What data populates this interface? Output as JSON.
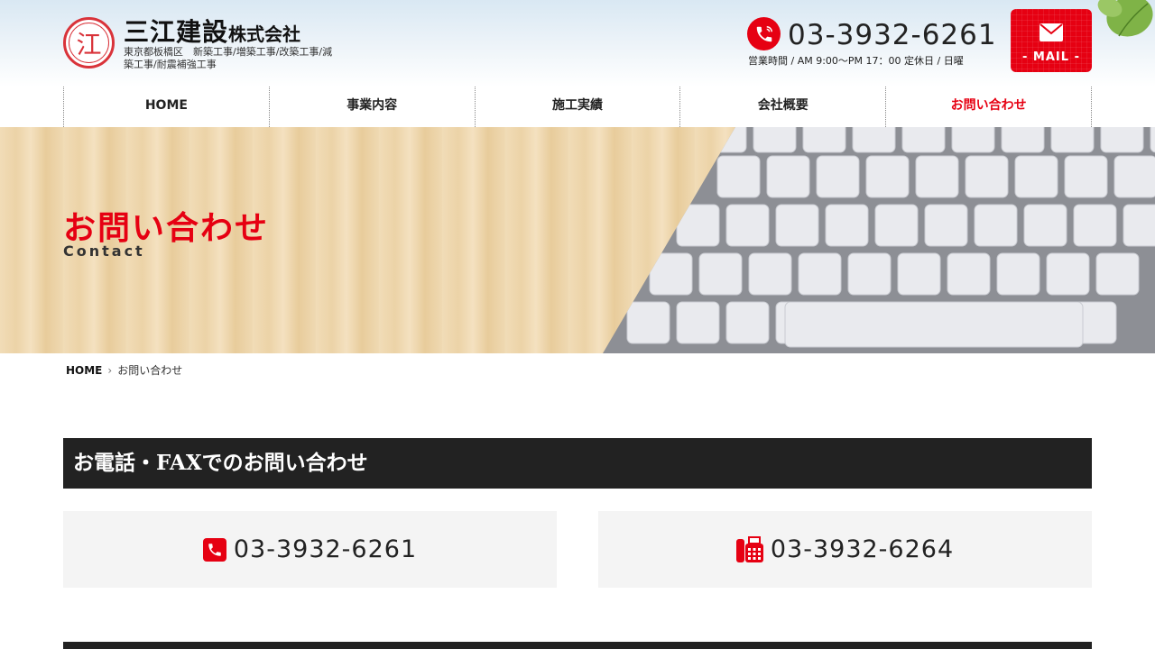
{
  "header": {
    "logo_mark": "江",
    "company_name_main": "三江建設",
    "company_name_suffix": "株式会社",
    "description": "東京都板橋区　新築工事/増築工事/改築工事/減築工事/耐震補強工事",
    "phone": "03-3932-6261",
    "hours": "営業時間 / AM 9:00〜PM 17：00 定休日 / 日曜",
    "mail_label": "- MAIL -"
  },
  "nav": {
    "items": [
      {
        "label": "HOME"
      },
      {
        "label": "事業内容"
      },
      {
        "label": "施工実績"
      },
      {
        "label": "会社概要"
      },
      {
        "label": "お問い合わせ"
      }
    ]
  },
  "hero": {
    "title": "お問い合わせ",
    "subtitle": "Contact"
  },
  "breadcrumb": {
    "home": "HOME",
    "current": "お問い合わせ"
  },
  "section": {
    "heading": "お電話・FAXでのお問い合わせ",
    "tel": "03-3932-6261",
    "fax": "03-3932-6264"
  },
  "colors": {
    "accent": "#e60012",
    "dark": "#222222"
  }
}
